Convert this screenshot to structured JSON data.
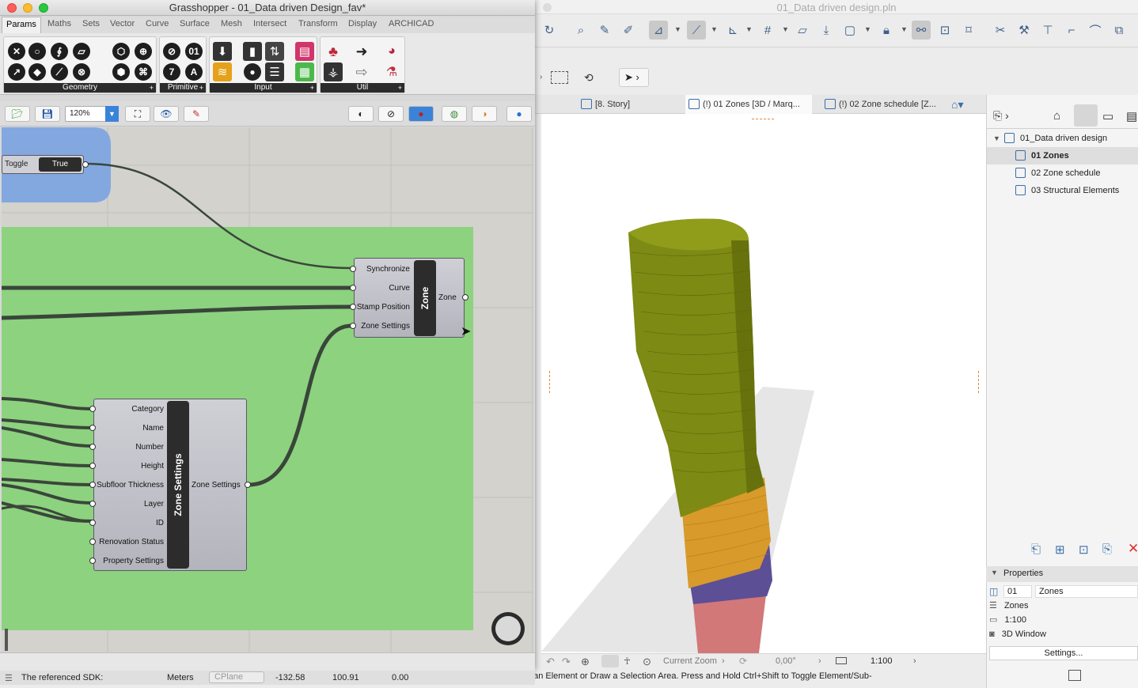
{
  "grasshopper": {
    "window_title": "Grasshopper - 01_Data driven Design_fav*",
    "menu_tabs": [
      "Params",
      "Maths",
      "Sets",
      "Vector",
      "Curve",
      "Surface",
      "Mesh",
      "Intersect",
      "Transform",
      "Display",
      "ARCHICAD"
    ],
    "active_tab": "Params",
    "ribbon_groups": [
      "Geometry",
      "Primitive",
      "Input",
      "Util"
    ],
    "zoom": "120%",
    "canvas": {
      "toggle": {
        "label": "Toggle",
        "value": "True"
      },
      "zone_component": {
        "name": "Zone",
        "inputs": [
          "Synchronize",
          "Curve",
          "Stamp Position",
          "Zone Settings"
        ],
        "output": "Zone"
      },
      "zone_settings_component": {
        "name": "Zone Settings",
        "inputs": [
          "Category",
          "Name",
          "Number",
          "Height",
          "Subfloor Thickness",
          "Layer",
          "ID",
          "Renovation Status",
          "Property Settings"
        ],
        "output": "Zone Settings"
      }
    },
    "status": {
      "message": "The referenced SDK:",
      "units": "Meters",
      "plane": "CPlane",
      "x": "-132.58",
      "y": "100.91",
      "z": "0.00"
    }
  },
  "archicad": {
    "window_title": "01_Data driven design.pln",
    "view_tabs": [
      {
        "label": "[8. Story]"
      },
      {
        "label": "(!) 01 Zones [3D / Marq..."
      },
      {
        "label": "(!) 02 Zone schedule [Z..."
      }
    ],
    "navigator": {
      "root": "01_Data driven design",
      "items": [
        "01 Zones",
        "02 Zone schedule",
        "03 Structural Elements"
      ],
      "selected": "01 Zones"
    },
    "properties": {
      "header": "Properties",
      "id": "01",
      "name": "Zones",
      "layer": "Zones",
      "scale": "1:100",
      "window": "3D Window",
      "settings_button": "Settings..."
    },
    "view_status": {
      "zoom_label": "Current Zoom",
      "angle": "0,00°",
      "scale": "1:100"
    },
    "bottom_message": ": an Element or Draw a Selection Area. Press and Hold Ctrl+Shift to Toggle Element/Sub-"
  },
  "colors": {
    "canvas_bg": "#d3d2cd",
    "group_green": "#8dd27f",
    "group_blue": "#83a8e0",
    "wire": "#3a463a",
    "tower_olive": "#7d8a13",
    "tower_orange": "#d89a2a",
    "tower_purple": "#5c4f96",
    "tower_pink": "#d27878"
  }
}
